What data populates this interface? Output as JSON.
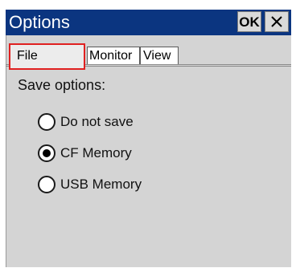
{
  "window": {
    "title": "Options",
    "ok_label": "OK",
    "close_icon": "close-icon",
    "title_bar_color": "#0b3580"
  },
  "tabs": [
    {
      "label": "File",
      "selected": true,
      "highlighted": true
    },
    {
      "label": "Monitor",
      "selected": false
    },
    {
      "label": "View",
      "selected": false
    }
  ],
  "save_options": {
    "label": "Save options:",
    "choices": [
      {
        "label": "Do not save",
        "checked": false
      },
      {
        "label": "CF Memory",
        "checked": true
      },
      {
        "label": "USB Memory",
        "checked": false
      }
    ]
  },
  "highlight_color": "#e02020"
}
